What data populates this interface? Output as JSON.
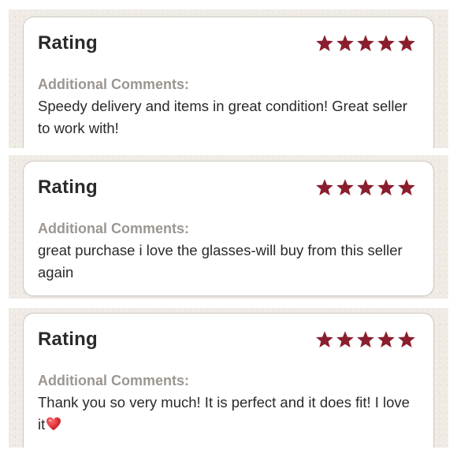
{
  "reviews": [
    {
      "rating_label": "Rating",
      "stars": 5,
      "star_color": "#8b1e2e",
      "comments_label": "Additional Comments:",
      "comment": "Speedy delivery and items in great condition! Great seller to work with!"
    },
    {
      "rating_label": "Rating",
      "stars": 5,
      "star_color": "#8b1e2e",
      "comments_label": "Additional Comments:",
      "comment": "great purchase i love the glasses-will buy from this seller again"
    },
    {
      "rating_label": "Rating",
      "stars": 5,
      "star_color": "#8b1e2e",
      "comments_label": "Additional Comments:",
      "comment": "Thank you so very much! It is perfect and it does fit! I love it",
      "emoji": "heart-emoji-icon"
    }
  ]
}
